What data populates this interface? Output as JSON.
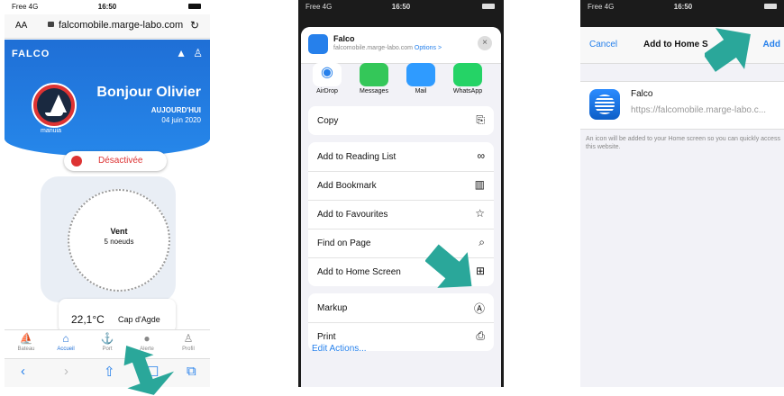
{
  "colors": {
    "accent": "#2680eb",
    "arrow": "#2aa79a",
    "alert": "#d33"
  },
  "phone1": {
    "status": {
      "carrier": "Free 4G",
      "time": "16:50"
    },
    "urlbar": {
      "aa": "AA",
      "url": "falcomobile.marge-labo.com"
    },
    "hero": {
      "logo": "FALCO",
      "mode": "manuia",
      "greeting": "Bonjour Olivier",
      "today": "AUJOURD'HUI",
      "date": "04 juin 2020"
    },
    "status_label": "Désactivée",
    "compass": {
      "label": "Vent",
      "speed": "5 noeuds"
    },
    "weather": {
      "temp": "22,1°C",
      "location": "Cap d'Agde"
    },
    "tabs": [
      {
        "label": "Bateau",
        "icon": "boat-icon"
      },
      {
        "label": "Accueil",
        "icon": "home-icon"
      },
      {
        "label": "Port",
        "icon": "anchor-icon"
      },
      {
        "label": "Alerte",
        "icon": "alert-icon"
      },
      {
        "label": "Profil",
        "icon": "user-icon"
      }
    ]
  },
  "phone2": {
    "status": {
      "carrier": "Free 4G",
      "time": "16:50"
    },
    "header": {
      "title": "Falco",
      "url": "falcomobile.marge-labo.com",
      "options": "Options >"
    },
    "apps": [
      {
        "label": "AirDrop",
        "color": "#fff"
      },
      {
        "label": "Messages",
        "color": "#34c759"
      },
      {
        "label": "Mail",
        "color": "#2f9bff"
      },
      {
        "label": "WhatsApp",
        "color": "#25d366"
      }
    ],
    "group1": [
      {
        "label": "Copy",
        "icon": "copy-icon"
      }
    ],
    "group2": [
      {
        "label": "Add to Reading List",
        "icon": "glasses-icon"
      },
      {
        "label": "Add Bookmark",
        "icon": "book-icon"
      },
      {
        "label": "Add to Favourites",
        "icon": "star-icon"
      },
      {
        "label": "Find on Page",
        "icon": "search-icon"
      },
      {
        "label": "Add to Home Screen",
        "icon": "add-square-icon"
      }
    ],
    "group3": [
      {
        "label": "Markup",
        "icon": "markup-icon"
      },
      {
        "label": "Print",
        "icon": "printer-icon"
      }
    ],
    "edit": "Edit Actions..."
  },
  "phone3": {
    "status": {
      "carrier": "Free 4G",
      "time": "16:50"
    },
    "nav": {
      "cancel": "Cancel",
      "title": "Add to Home S",
      "add": "Add"
    },
    "app": {
      "name": "Falco",
      "url": "https://falcomobile.marge-labo.c..."
    },
    "note": "An icon will be added to your Home screen so you can quickly access this website."
  }
}
